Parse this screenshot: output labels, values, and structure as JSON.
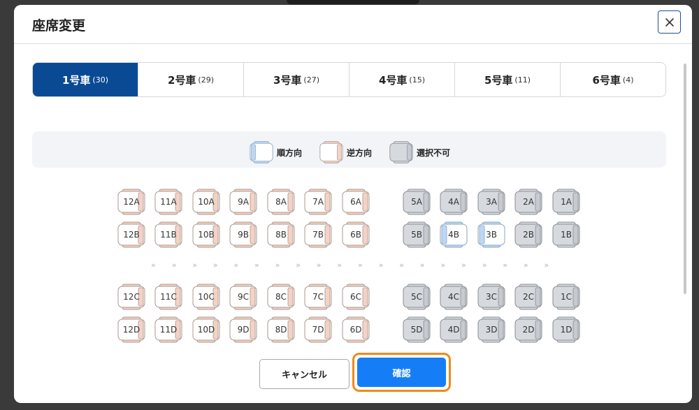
{
  "dialog": {
    "title": "座席変更",
    "close_icon": "close-icon"
  },
  "tabs": [
    {
      "label": "1号車",
      "count": "(30)",
      "active": true
    },
    {
      "label": "2号車",
      "count": "(29)",
      "active": false
    },
    {
      "label": "3号車",
      "count": "(27)",
      "active": false
    },
    {
      "label": "4号車",
      "count": "(15)",
      "active": false
    },
    {
      "label": "5号車",
      "count": "(11)",
      "active": false
    },
    {
      "label": "6号車",
      "count": "(4)",
      "active": false
    }
  ],
  "legend": [
    {
      "label": "順方向",
      "type": "forward"
    },
    {
      "label": "逆方向",
      "type": "reverse"
    },
    {
      "label": "選択不可",
      "type": "unavailable"
    }
  ],
  "seat_rows": [
    [
      {
        "label": "12A",
        "type": "reverse"
      },
      {
        "label": "11A",
        "type": "reverse"
      },
      {
        "label": "10A",
        "type": "reverse"
      },
      {
        "label": "9A",
        "type": "reverse"
      },
      {
        "label": "8A",
        "type": "reverse"
      },
      {
        "label": "7A",
        "type": "reverse"
      },
      {
        "label": "6A",
        "type": "reverse"
      },
      {
        "label": "5A",
        "type": "unavailable"
      },
      {
        "label": "4A",
        "type": "unavailable"
      },
      {
        "label": "3A",
        "type": "unavailable"
      },
      {
        "label": "2A",
        "type": "unavailable"
      },
      {
        "label": "1A",
        "type": "unavailable"
      }
    ],
    [
      {
        "label": "12B",
        "type": "reverse"
      },
      {
        "label": "11B",
        "type": "reverse"
      },
      {
        "label": "10B",
        "type": "reverse"
      },
      {
        "label": "9B",
        "type": "reverse"
      },
      {
        "label": "8B",
        "type": "reverse"
      },
      {
        "label": "7B",
        "type": "reverse"
      },
      {
        "label": "6B",
        "type": "reverse"
      },
      {
        "label": "5B",
        "type": "unavailable"
      },
      {
        "label": "4B",
        "type": "forward"
      },
      {
        "label": "3B",
        "type": "forward"
      },
      {
        "label": "2B",
        "type": "unavailable"
      },
      {
        "label": "1B",
        "type": "unavailable"
      }
    ],
    [
      {
        "label": "12C",
        "type": "reverse"
      },
      {
        "label": "11C",
        "type": "reverse"
      },
      {
        "label": "10C",
        "type": "reverse"
      },
      {
        "label": "9C",
        "type": "reverse"
      },
      {
        "label": "8C",
        "type": "reverse"
      },
      {
        "label": "7C",
        "type": "reverse"
      },
      {
        "label": "6C",
        "type": "reverse"
      },
      {
        "label": "5C",
        "type": "unavailable"
      },
      {
        "label": "4C",
        "type": "unavailable"
      },
      {
        "label": "3C",
        "type": "unavailable"
      },
      {
        "label": "2C",
        "type": "unavailable"
      },
      {
        "label": "1C",
        "type": "unavailable"
      }
    ],
    [
      {
        "label": "12D",
        "type": "reverse"
      },
      {
        "label": "11D",
        "type": "reverse"
      },
      {
        "label": "10D",
        "type": "reverse"
      },
      {
        "label": "9D",
        "type": "reverse"
      },
      {
        "label": "8D",
        "type": "reverse"
      },
      {
        "label": "7D",
        "type": "reverse"
      },
      {
        "label": "6D",
        "type": "reverse"
      },
      {
        "label": "5D",
        "type": "unavailable"
      },
      {
        "label": "4D",
        "type": "unavailable"
      },
      {
        "label": "3D",
        "type": "unavailable"
      },
      {
        "label": "2D",
        "type": "unavailable"
      },
      {
        "label": "1D",
        "type": "unavailable"
      }
    ]
  ],
  "aisle_arrows": [
    "»",
    "»",
    "»",
    "»",
    "»",
    "»",
    "»",
    "»",
    "»",
    "»",
    "»",
    "»",
    "»",
    "»",
    "»",
    "»",
    "»",
    "»",
    "»",
    "»"
  ],
  "buttons": {
    "cancel": "キャンセル",
    "confirm": "確認"
  },
  "colors": {
    "tab_active": "#0a4a95",
    "confirm": "#157ef7",
    "confirm_focus_ring": "#f08a18",
    "forward_accent": "#bcd8f5",
    "reverse_accent": "#f6d2c4",
    "unavailable_fill": "#d6d9de"
  }
}
